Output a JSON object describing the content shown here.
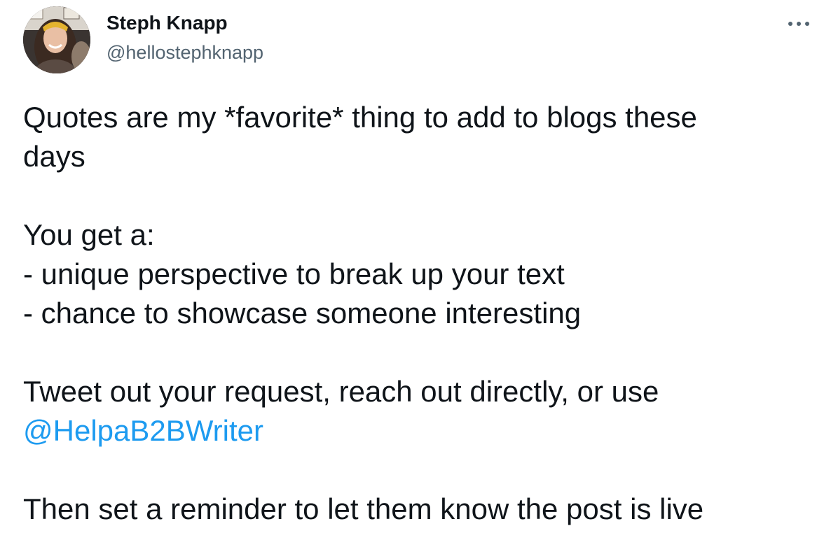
{
  "author": {
    "display_name": "Steph Knapp",
    "handle": "@hellostephknapp",
    "avatar": "profile-photo"
  },
  "more_icon": "more-horizontal-icon",
  "tweet": {
    "lines": [
      "Quotes are my *favorite* thing to add to blogs these",
      "days",
      "",
      "You get a:",
      "- unique perspective to break up your text",
      "- chance to showcase someone interesting",
      "",
      "Tweet out your request, reach out directly, or use"
    ],
    "mention": "@HelpaB2BWriter",
    "last_line": "Then set a reminder to let them know the post is live"
  },
  "colors": {
    "text": "#0f1419",
    "secondary": "#536471",
    "link": "#1d9bf0"
  }
}
